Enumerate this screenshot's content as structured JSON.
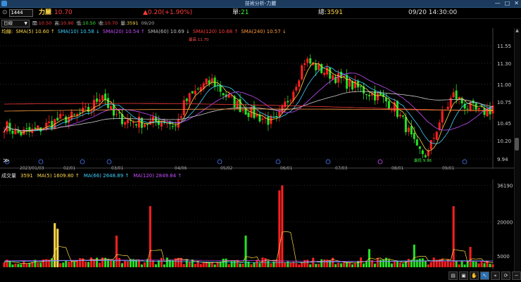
{
  "window": {
    "title": "技術分析-力麗",
    "minimize": "—",
    "maximize": "□",
    "close": "✕"
  },
  "quote": {
    "code": "1444",
    "name": "力麗",
    "price": "10.70",
    "change": "▲0.20(+1.90%)",
    "volume_label": "單:",
    "volume": "21",
    "total_label": "總:",
    "total": "3591",
    "datetime": "09/20 14:30:00"
  },
  "toolbar": {
    "period": "日線",
    "ohlc": [
      {
        "label": "開:",
        "value": "10.50",
        "tone": "r"
      },
      {
        "label": "高:",
        "value": "10.90",
        "tone": "r"
      },
      {
        "label": "低:",
        "value": "10.50",
        "tone": "g"
      },
      {
        "label": "收:",
        "value": "10.70",
        "tone": "r"
      },
      {
        "label": "量:",
        "value": "3591",
        "tone": "y"
      },
      {
        "label": "",
        "value": "09/20",
        "tone": "w"
      }
    ]
  },
  "ma_legend": {
    "title": "均線:",
    "items": [
      {
        "text": "SMA(5) 10.60 ↑",
        "color": "#ffd94a"
      },
      {
        "text": "SMA(10) 10.58 ↓",
        "color": "#3fd0ff"
      },
      {
        "text": "SMA(20) 10.54 ↑",
        "color": "#c84dff"
      },
      {
        "text": "SMA(60) 10.69 ↓",
        "color": "#bbbbbb"
      },
      {
        "text": "SMA(120) 10.68 ↑",
        "color": "#ff3b3b"
      },
      {
        "text": "SMA(240) 10.57 ↓",
        "color": "#ff9a3c"
      }
    ]
  },
  "vol_legend": {
    "title": "成交量",
    "items": [
      {
        "text": "3591",
        "color": "#ffd94a"
      },
      {
        "text": "MA(5) 1609.80 ↑",
        "color": "#ffd94a"
      },
      {
        "text": "MA(66) 2648.89 ↑",
        "color": "#3fd0ff"
      },
      {
        "text": "MA(120) 2849.84 ↑",
        "color": "#c84dff"
      }
    ]
  },
  "colors": {
    "up": "#ff2020",
    "down": "#26e026",
    "yellow": "#ffd94a",
    "cyan": "#3fd0ff",
    "purple": "#c84dff",
    "grey": "#aaaaaa",
    "red": "#ff3b3b",
    "grid": "#2a2a2a"
  },
  "chart_data": {
    "type": "candlestick",
    "price_axis": [
      "11.55",
      "11.30",
      "11.00",
      "10.75",
      "10.45",
      "10.20",
      "9.94"
    ],
    "volume_axis": [
      "36190",
      "20000",
      "5000"
    ],
    "date_labels": [
      "2023/01/03",
      "02/01",
      "03/01",
      "04/06",
      "05/02",
      "06/01",
      "07/03",
      "08/01",
      "09/01"
    ],
    "high_annotation": "最高 11.70",
    "low_annotation": "最低 9.96",
    "ylim": [
      9.9,
      11.75
    ],
    "vol_max": 37000
  },
  "toolbar_icons": [
    "print-icon",
    "save-icon",
    "pan-icon",
    "cursor-icon",
    "zoom-icon",
    "refresh-icon",
    "zoom-out-icon",
    "zoom-in-icon"
  ],
  "toolbar_glyphs": [
    "▤",
    "▣",
    "✋",
    "↖",
    "⌖",
    "⟳",
    "−",
    "+"
  ],
  "nav": {
    "prev": "≫"
  }
}
